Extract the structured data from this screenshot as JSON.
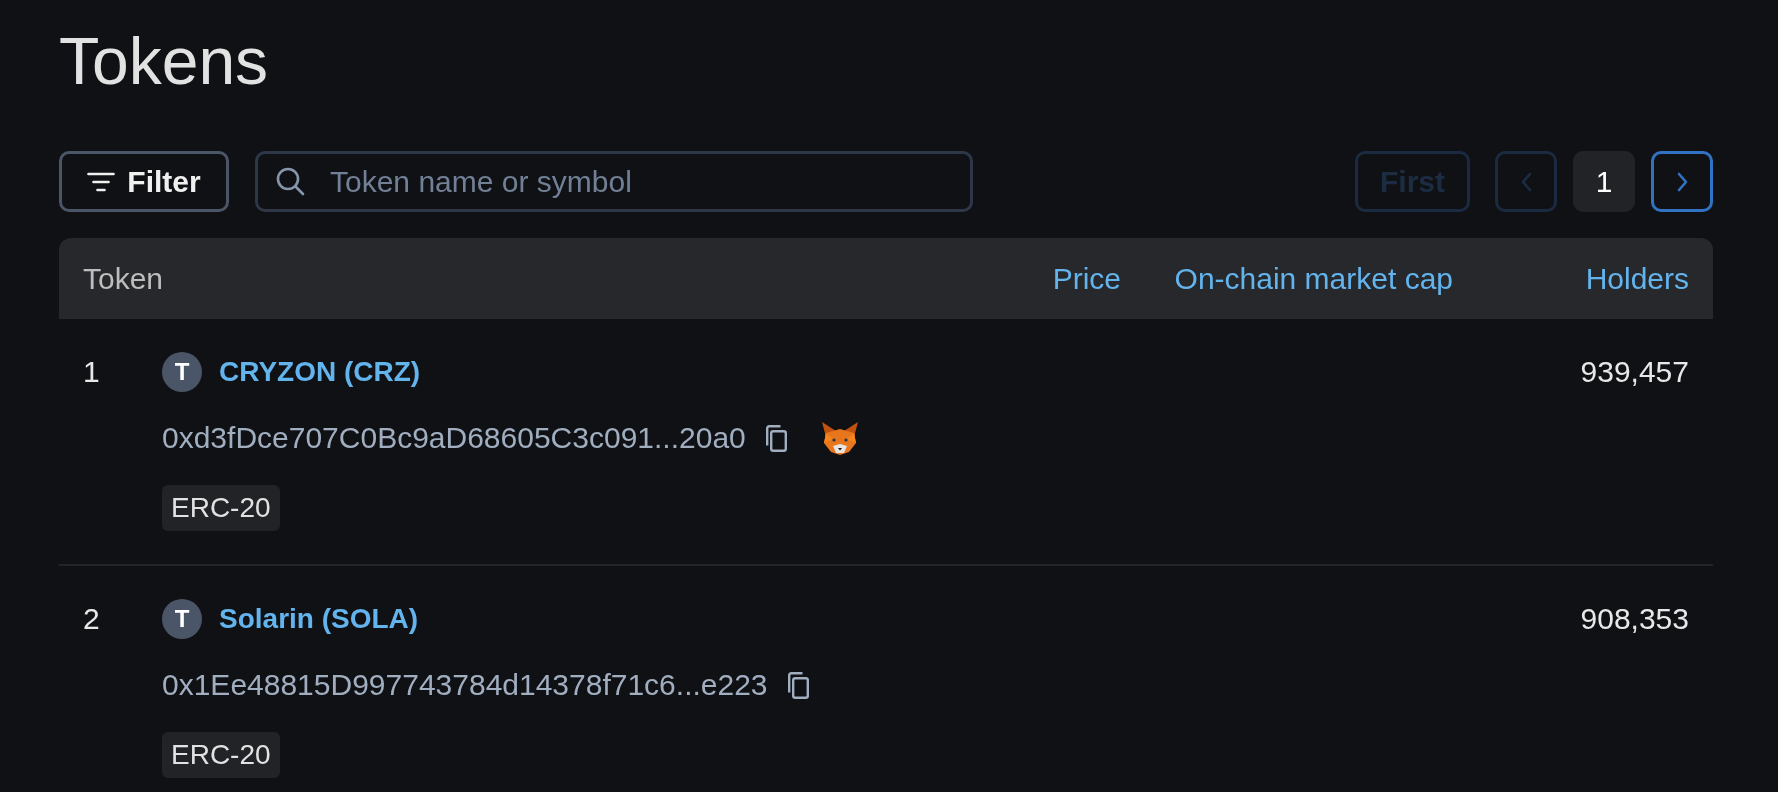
{
  "title": "Tokens",
  "toolbar": {
    "filter_button": {
      "label": "Filter"
    },
    "search": {
      "placeholder": "Token name or symbol"
    }
  },
  "pagination": [
    {
      "kind": "first",
      "label": "First",
      "disabled": true
    },
    {
      "kind": "prev",
      "disabled": true
    },
    {
      "kind": "page",
      "label": "1",
      "selected": true
    },
    {
      "kind": "next",
      "disabled": false
    }
  ],
  "table": {
    "columns": [
      {
        "label": "Token",
        "sortable": false
      },
      {
        "label": "Price",
        "sortable": true
      },
      {
        "label": "On-chain market cap",
        "sortable": true
      },
      {
        "label": "Holders",
        "sortable": true
      }
    ],
    "rows": [
      {
        "number": "1",
        "avatar": "T",
        "name": "CRYZON (CRZ)",
        "address": "0xd3fDce707C0Bc9aD68605C3c091...20a0",
        "add_to_wallet": true,
        "type": "ERC-20",
        "holders": "939,457"
      },
      {
        "number": "2",
        "avatar": "T",
        "name": "Solarin (SOLA)",
        "address": "0x1Ee48815D997743784d14378f71c6...e223",
        "add_to_wallet": false,
        "type": "ERC-20",
        "holders": "908,353"
      }
    ]
  }
}
